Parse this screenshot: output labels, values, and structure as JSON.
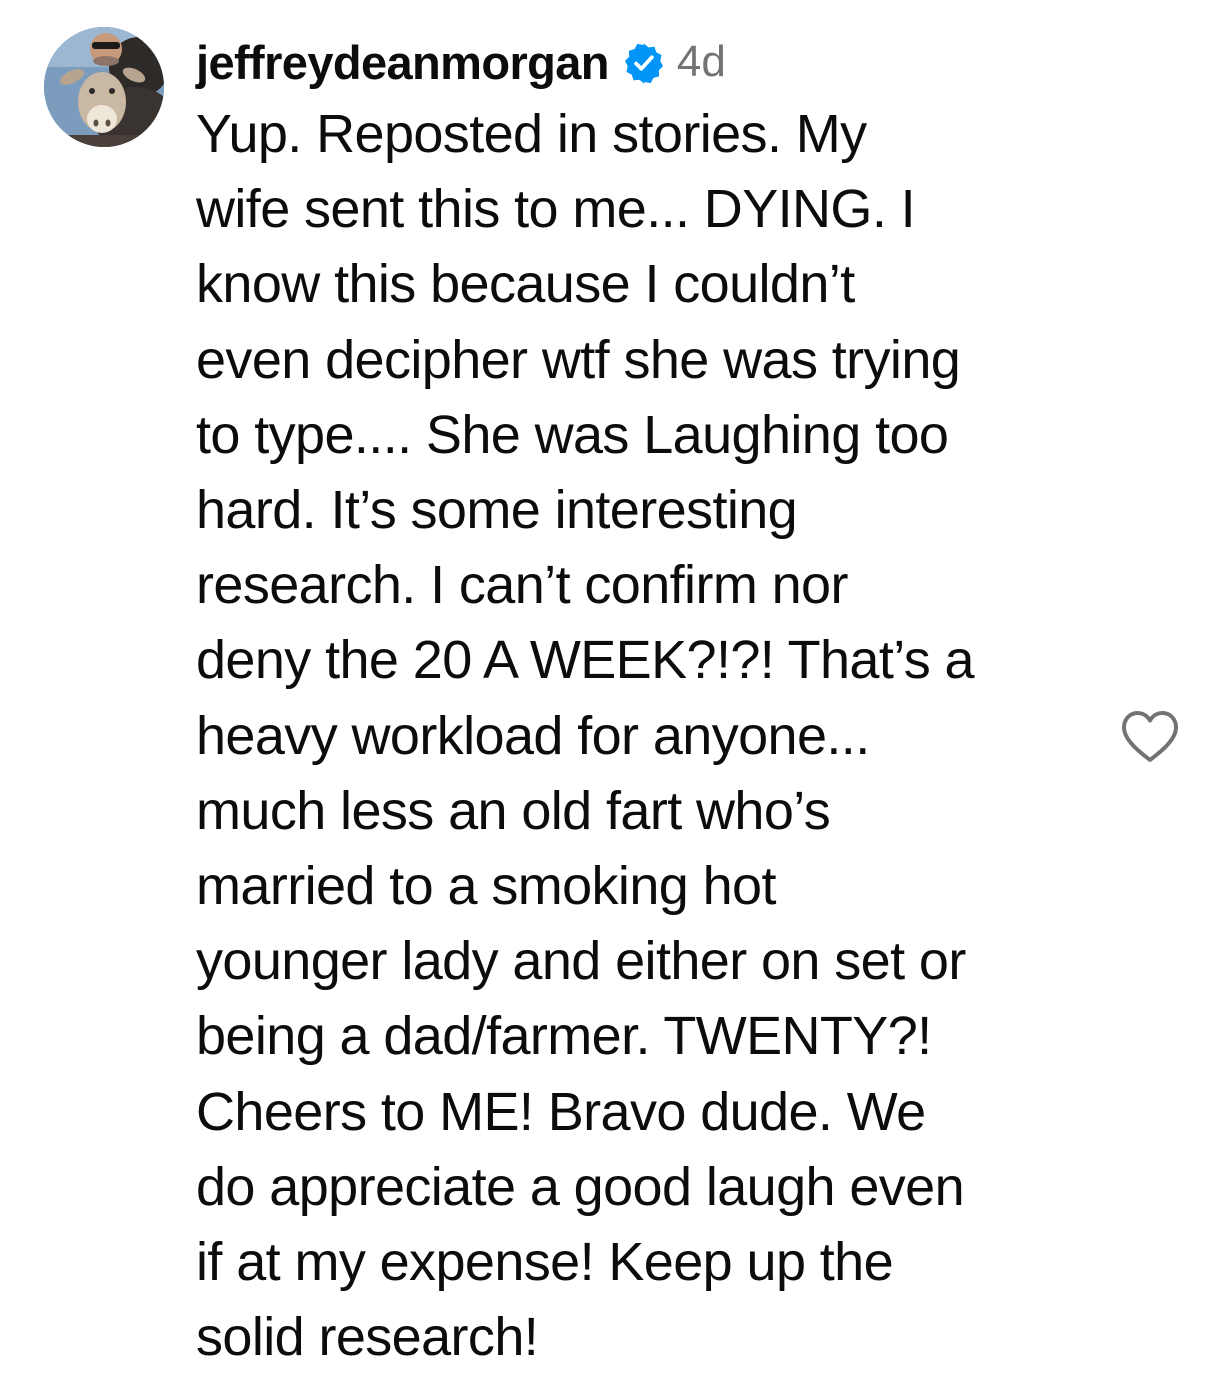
{
  "comment": {
    "username": "jeffreydeanmorgan",
    "verified": true,
    "verified_icon": "verified-badge-icon",
    "timestamp": "4d",
    "avatar_icon": "profile-photo-avatar",
    "like_icon": "heart-outline-icon",
    "colors": {
      "verified_blue": "#0095f6",
      "timestamp_gray": "#737373",
      "text": "#0c0c0c",
      "heart_outline": "#737373"
    },
    "lines": [
      "Yup. Reposted in stories. My",
      "wife sent this to me... DYING. I",
      "know this because I couldn’t",
      "even decipher wtf she was trying",
      "to type.... She was Laughing too",
      "hard. It’s some interesting",
      "research. I can’t confirm nor",
      "deny the 20 A WEEK?!?! That’s a",
      "heavy workload for anyone...",
      "much less an old fart who’s",
      "married to a smoking hot",
      "younger lady and either on set or",
      "being a dad/farmer. TWENTY?!",
      "Cheers to ME! Bravo dude. We",
      "do appreciate a good laugh even",
      "if at my expense! Keep up the",
      "solid research!"
    ]
  }
}
